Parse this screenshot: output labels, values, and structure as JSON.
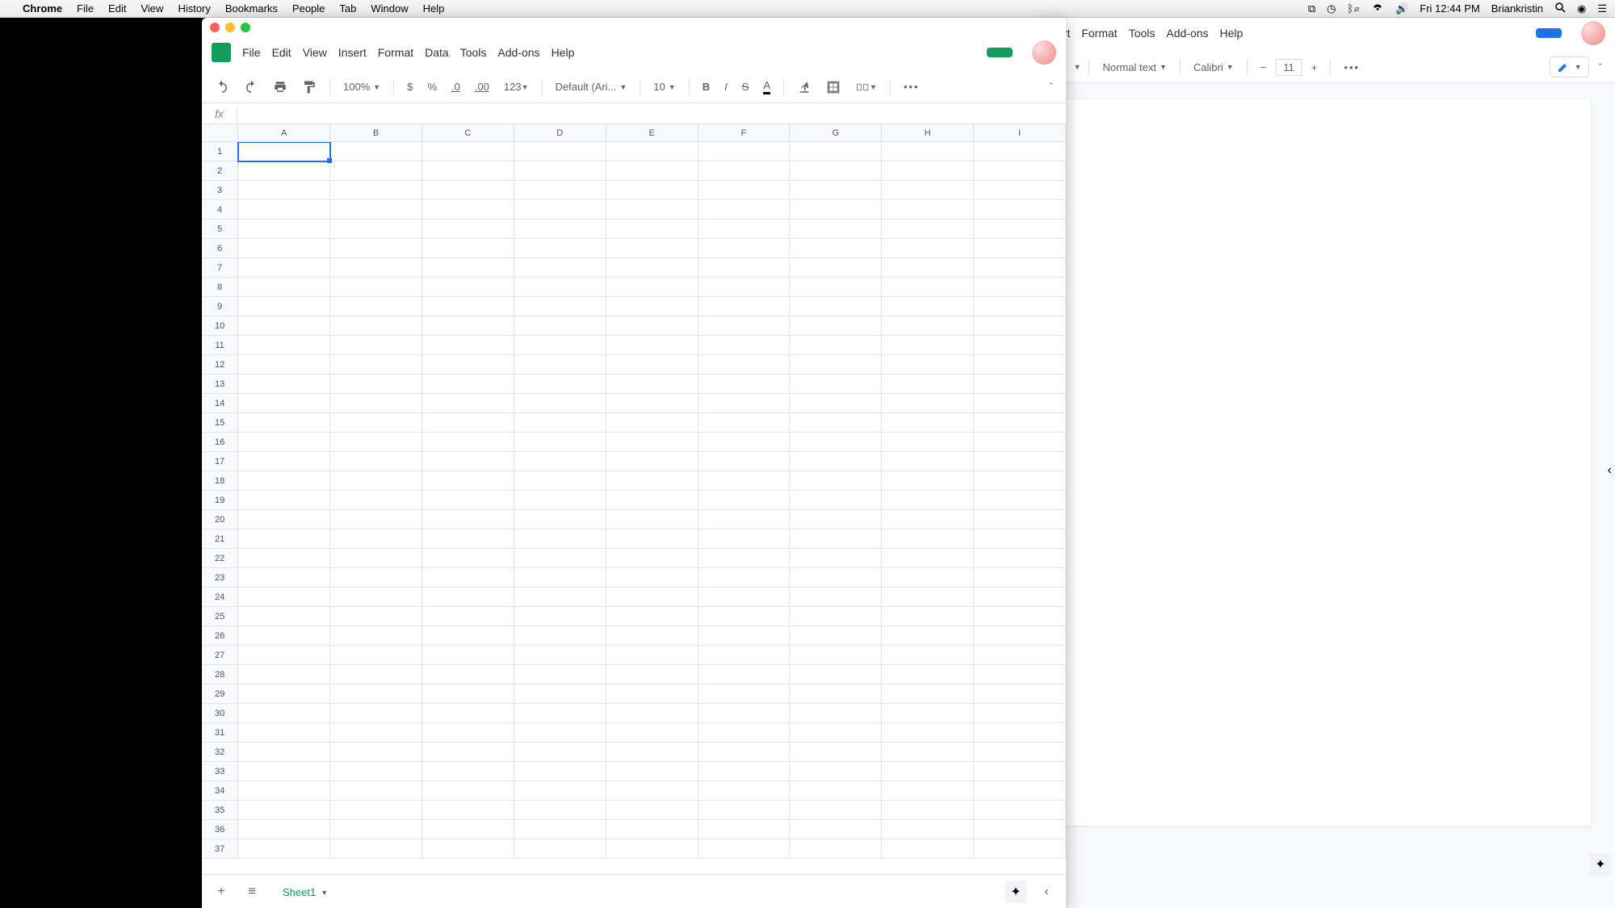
{
  "macos_menubar": {
    "app_name": "Chrome",
    "menus": [
      "File",
      "Edit",
      "View",
      "History",
      "Bookmarks",
      "People",
      "Tab",
      "Window",
      "Help"
    ],
    "status": {
      "time": "Fri 12:44 PM",
      "user": "Briankristin"
    }
  },
  "sheets_window": {
    "menus": [
      "File",
      "Edit",
      "View",
      "Insert",
      "Format",
      "Data",
      "Tools",
      "Add-ons",
      "Help"
    ],
    "toolbar": {
      "zoom": "100%",
      "currency": "$",
      "percent": "%",
      "dec_dec": ".0",
      "inc_dec": ".00",
      "format_num": "123",
      "font": "Default (Ari...",
      "font_size": "10"
    },
    "formula_bar": {
      "fx": "fx",
      "value": ""
    },
    "columns": [
      "A",
      "B",
      "C",
      "D",
      "E",
      "F",
      "G",
      "H",
      "I"
    ],
    "row_count": 37,
    "selected": "A1",
    "tabs": {
      "add": "+",
      "list": "≡",
      "sheet_name": "Sheet1"
    }
  },
  "docs_window": {
    "menus_visible": [
      "sert",
      "Format",
      "Tools",
      "Add-ons",
      "Help"
    ],
    "toolbar": {
      "style": "Normal text",
      "font": "Calibri",
      "font_size": "11",
      "dec": "−",
      "inc": "+"
    }
  }
}
